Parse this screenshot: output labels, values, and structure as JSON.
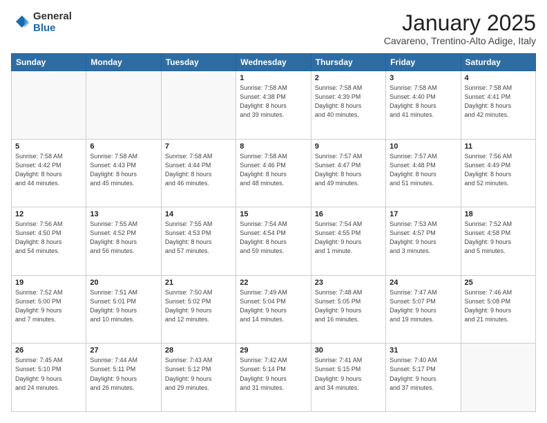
{
  "header": {
    "logo_general": "General",
    "logo_blue": "Blue",
    "month_title": "January 2025",
    "location": "Cavareno, Trentino-Alto Adige, Italy"
  },
  "days_of_week": [
    "Sunday",
    "Monday",
    "Tuesday",
    "Wednesday",
    "Thursday",
    "Friday",
    "Saturday"
  ],
  "weeks": [
    [
      {
        "day": "",
        "info": ""
      },
      {
        "day": "",
        "info": ""
      },
      {
        "day": "",
        "info": ""
      },
      {
        "day": "1",
        "info": "Sunrise: 7:58 AM\nSunset: 4:38 PM\nDaylight: 8 hours\nand 39 minutes."
      },
      {
        "day": "2",
        "info": "Sunrise: 7:58 AM\nSunset: 4:39 PM\nDaylight: 8 hours\nand 40 minutes."
      },
      {
        "day": "3",
        "info": "Sunrise: 7:58 AM\nSunset: 4:40 PM\nDaylight: 8 hours\nand 41 minutes."
      },
      {
        "day": "4",
        "info": "Sunrise: 7:58 AM\nSunset: 4:41 PM\nDaylight: 8 hours\nand 42 minutes."
      }
    ],
    [
      {
        "day": "5",
        "info": "Sunrise: 7:58 AM\nSunset: 4:42 PM\nDaylight: 8 hours\nand 44 minutes."
      },
      {
        "day": "6",
        "info": "Sunrise: 7:58 AM\nSunset: 4:43 PM\nDaylight: 8 hours\nand 45 minutes."
      },
      {
        "day": "7",
        "info": "Sunrise: 7:58 AM\nSunset: 4:44 PM\nDaylight: 8 hours\nand 46 minutes."
      },
      {
        "day": "8",
        "info": "Sunrise: 7:58 AM\nSunset: 4:46 PM\nDaylight: 8 hours\nand 48 minutes."
      },
      {
        "day": "9",
        "info": "Sunrise: 7:57 AM\nSunset: 4:47 PM\nDaylight: 8 hours\nand 49 minutes."
      },
      {
        "day": "10",
        "info": "Sunrise: 7:57 AM\nSunset: 4:48 PM\nDaylight: 8 hours\nand 51 minutes."
      },
      {
        "day": "11",
        "info": "Sunrise: 7:56 AM\nSunset: 4:49 PM\nDaylight: 8 hours\nand 52 minutes."
      }
    ],
    [
      {
        "day": "12",
        "info": "Sunrise: 7:56 AM\nSunset: 4:50 PM\nDaylight: 8 hours\nand 54 minutes."
      },
      {
        "day": "13",
        "info": "Sunrise: 7:55 AM\nSunset: 4:52 PM\nDaylight: 8 hours\nand 56 minutes."
      },
      {
        "day": "14",
        "info": "Sunrise: 7:55 AM\nSunset: 4:53 PM\nDaylight: 8 hours\nand 57 minutes."
      },
      {
        "day": "15",
        "info": "Sunrise: 7:54 AM\nSunset: 4:54 PM\nDaylight: 8 hours\nand 59 minutes."
      },
      {
        "day": "16",
        "info": "Sunrise: 7:54 AM\nSunset: 4:55 PM\nDaylight: 9 hours\nand 1 minute."
      },
      {
        "day": "17",
        "info": "Sunrise: 7:53 AM\nSunset: 4:57 PM\nDaylight: 9 hours\nand 3 minutes."
      },
      {
        "day": "18",
        "info": "Sunrise: 7:52 AM\nSunset: 4:58 PM\nDaylight: 9 hours\nand 5 minutes."
      }
    ],
    [
      {
        "day": "19",
        "info": "Sunrise: 7:52 AM\nSunset: 5:00 PM\nDaylight: 9 hours\nand 7 minutes."
      },
      {
        "day": "20",
        "info": "Sunrise: 7:51 AM\nSunset: 5:01 PM\nDaylight: 9 hours\nand 10 minutes."
      },
      {
        "day": "21",
        "info": "Sunrise: 7:50 AM\nSunset: 5:02 PM\nDaylight: 9 hours\nand 12 minutes."
      },
      {
        "day": "22",
        "info": "Sunrise: 7:49 AM\nSunset: 5:04 PM\nDaylight: 9 hours\nand 14 minutes."
      },
      {
        "day": "23",
        "info": "Sunrise: 7:48 AM\nSunset: 5:05 PM\nDaylight: 9 hours\nand 16 minutes."
      },
      {
        "day": "24",
        "info": "Sunrise: 7:47 AM\nSunset: 5:07 PM\nDaylight: 9 hours\nand 19 minutes."
      },
      {
        "day": "25",
        "info": "Sunrise: 7:46 AM\nSunset: 5:08 PM\nDaylight: 9 hours\nand 21 minutes."
      }
    ],
    [
      {
        "day": "26",
        "info": "Sunrise: 7:45 AM\nSunset: 5:10 PM\nDaylight: 9 hours\nand 24 minutes."
      },
      {
        "day": "27",
        "info": "Sunrise: 7:44 AM\nSunset: 5:11 PM\nDaylight: 9 hours\nand 26 minutes."
      },
      {
        "day": "28",
        "info": "Sunrise: 7:43 AM\nSunset: 5:12 PM\nDaylight: 9 hours\nand 29 minutes."
      },
      {
        "day": "29",
        "info": "Sunrise: 7:42 AM\nSunset: 5:14 PM\nDaylight: 9 hours\nand 31 minutes."
      },
      {
        "day": "30",
        "info": "Sunrise: 7:41 AM\nSunset: 5:15 PM\nDaylight: 9 hours\nand 34 minutes."
      },
      {
        "day": "31",
        "info": "Sunrise: 7:40 AM\nSunset: 5:17 PM\nDaylight: 9 hours\nand 37 minutes."
      },
      {
        "day": "",
        "info": ""
      }
    ]
  ]
}
